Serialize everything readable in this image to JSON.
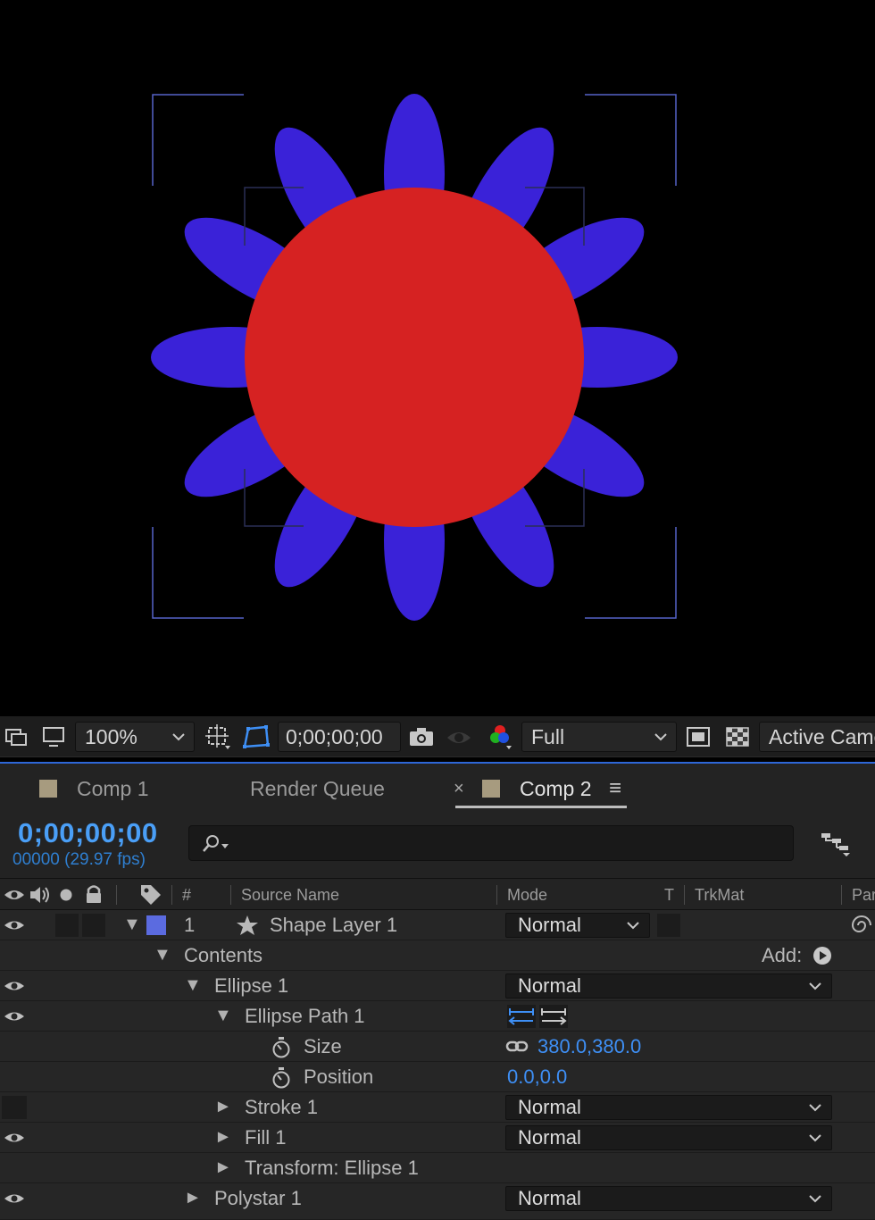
{
  "viewer_toolbar": {
    "zoom": "100%",
    "timecode": "0;00;00;00",
    "resolution": "Full",
    "camera": "Active Camera"
  },
  "tabs": [
    {
      "label": "Comp 1"
    },
    {
      "label": "Render Queue"
    },
    {
      "label": "Comp 2"
    }
  ],
  "tab_close": "×",
  "tab_menu": "≡",
  "timeline": {
    "timecode": "0;00;00;00",
    "fps": "00000 (29.97 fps)",
    "search_placeholder": ""
  },
  "columns": {
    "hash": "#",
    "source_name": "Source Name",
    "mode": "Mode",
    "t": "T",
    "trkmat": "TrkMat",
    "parent": "Parent"
  },
  "layers": {
    "layer1": {
      "number": "1",
      "name": "Shape Layer 1",
      "mode": "Normal"
    },
    "contents": {
      "label": "Contents",
      "add_label": "Add:"
    },
    "ellipse1": {
      "label": "Ellipse 1",
      "mode": "Normal"
    },
    "ellipse_path1": {
      "label": "Ellipse Path 1"
    },
    "size": {
      "label": "Size",
      "value": "380.0,380.0"
    },
    "position": {
      "label": "Position",
      "value": "0.0,0.0"
    },
    "stroke1": {
      "label": "Stroke 1",
      "mode": "Normal"
    },
    "fill1": {
      "label": "Fill 1",
      "mode": "Normal"
    },
    "transform_ellipse1": {
      "label": "Transform: Ellipse 1"
    },
    "polystar1": {
      "label": "Polystar 1",
      "mode": "Normal"
    }
  },
  "colors": {
    "petal": "#3a22d8",
    "circle": "#d62222",
    "accent": "#4a9ff7",
    "label_swatch": "#a79b7f",
    "layer_label": "#5b6be0"
  }
}
